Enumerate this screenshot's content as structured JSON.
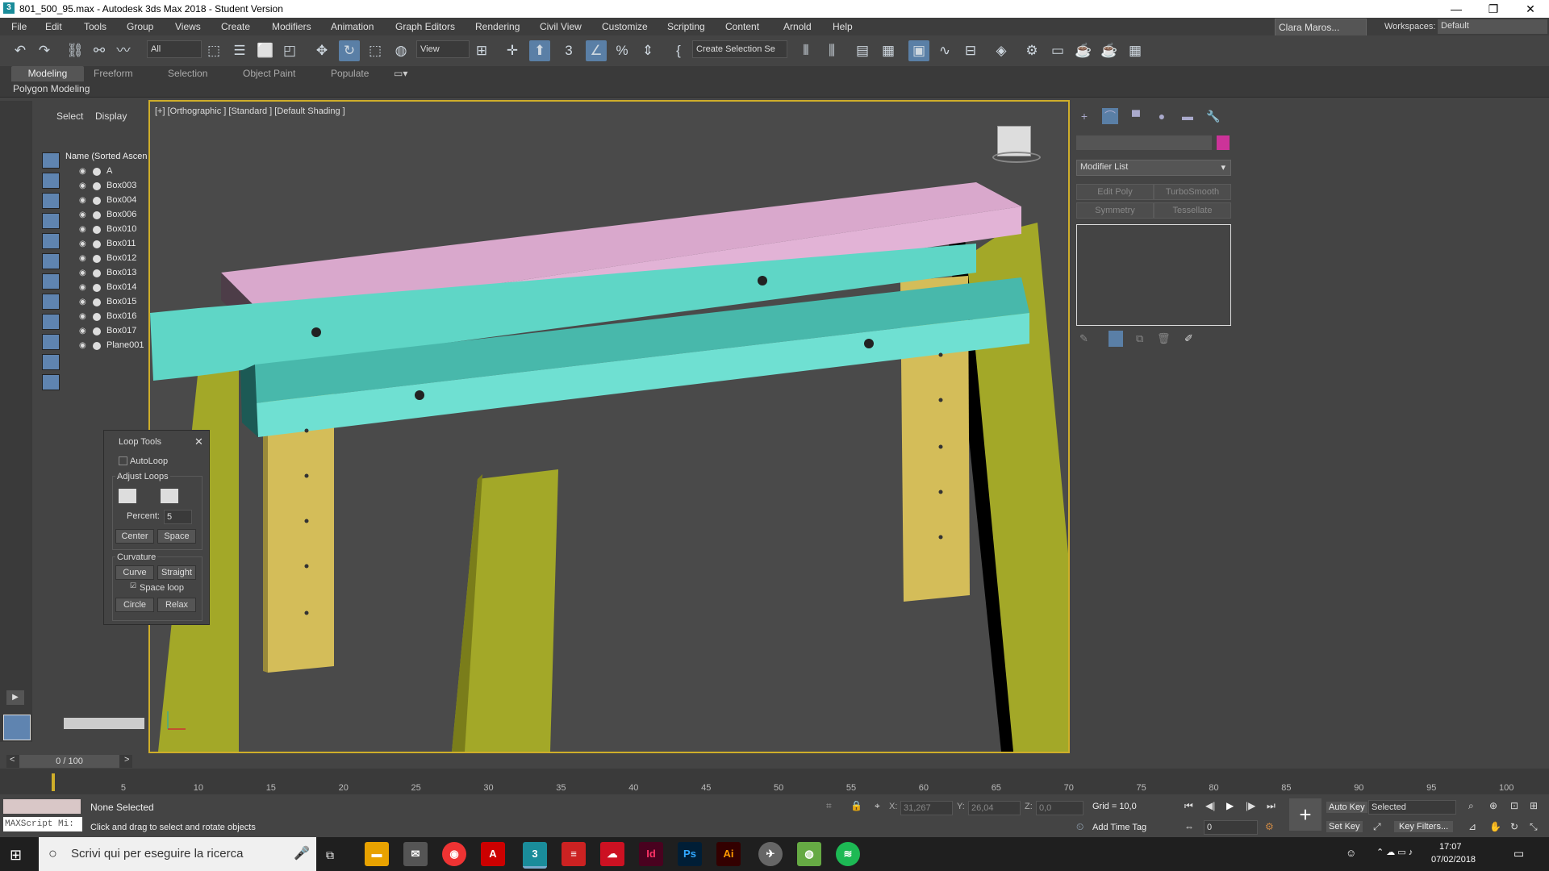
{
  "title_bar": {
    "title": "801_500_95.max - Autodesk 3ds Max 2018 - Student Version",
    "minimize": "—",
    "restore": "❐",
    "close": "✕",
    "app_glyph": "3"
  },
  "menu": [
    "File",
    "Edit",
    "Tools",
    "Group",
    "Views",
    "Create",
    "Modifiers",
    "Animation",
    "Graph Editors",
    "Rendering",
    "Civil View",
    "Customize",
    "Scripting",
    "Content",
    "Arnold",
    "Help"
  ],
  "user": "Clara Maros...",
  "workspaces": {
    "label": "Workspaces:",
    "value": "Default"
  },
  "toolbar": {
    "selection_filter": "All",
    "ref_coord": "View",
    "selection_set": "Create Selection Se"
  },
  "ribbon": {
    "tabs": [
      "Modeling",
      "Freeform",
      "Selection",
      "Object Paint",
      "Populate"
    ],
    "panel": "Polygon Modeling"
  },
  "scene_explorer": {
    "tabs": [
      "Select",
      "Display"
    ],
    "header": "Name (Sorted Ascen",
    "items": [
      "A",
      "Box003",
      "Box004",
      "Box006",
      "Box010",
      "Box011",
      "Box012",
      "Box013",
      "Box014",
      "Box015",
      "Box016",
      "Box017",
      "Plane001"
    ]
  },
  "viewport": {
    "label": "[+] [Orthographic ] [Standard ] [Default Shading ]"
  },
  "loop_tools": {
    "title": "Loop Tools",
    "autoloop": "AutoLoop",
    "adjust_loops": "Adjust Loops",
    "percent_label": "Percent:",
    "percent_value": "5",
    "center": "Center",
    "space": "Space",
    "curvature": "Curvature",
    "curve": "Curve",
    "straight": "Straight",
    "space_loop": "Space loop",
    "circle": "Circle",
    "relax": "Relax"
  },
  "command_panel": {
    "modifier_list": "Modifier List",
    "buttons": [
      "Edit Poly",
      "TurboSmooth",
      "Symmetry",
      "Tessellate"
    ]
  },
  "timeline": {
    "frame": "0 / 100",
    "ticks": [
      "5",
      "10",
      "15",
      "20",
      "25",
      "30",
      "35",
      "40",
      "45",
      "50",
      "55",
      "60",
      "65",
      "70",
      "75",
      "80",
      "85",
      "90",
      "95",
      "100"
    ]
  },
  "status": {
    "selected": "None Selected",
    "prompt": "Click and drag to select and rotate objects",
    "maxscript": "MAXScript Mi:",
    "x_label": "X:",
    "x_value": "31,267",
    "y_label": "Y:",
    "y_value": "26,04",
    "z_label": "Z:",
    "z_value": "0,0",
    "grid": "Grid = 10,0",
    "add_time_tag": "Add Time Tag",
    "auto_key": "Auto Key",
    "set_key": "Set Key",
    "key_mode": "Selected",
    "key_filters": "Key Filters...",
    "frame_field": "0"
  },
  "taskbar": {
    "search_placeholder": "Scrivi qui per eseguire la ricerca",
    "time": "17:07",
    "date": "07/02/2018",
    "apps": [
      "Id",
      "Ps",
      "Ai"
    ]
  },
  "colors": {
    "viewport_border": "#cfae2a",
    "pink_beam": "#d9a8cc",
    "teal_beam": "#5fd6c6",
    "olive_leg": "#a3a828",
    "tan_post": "#d4bd59"
  }
}
